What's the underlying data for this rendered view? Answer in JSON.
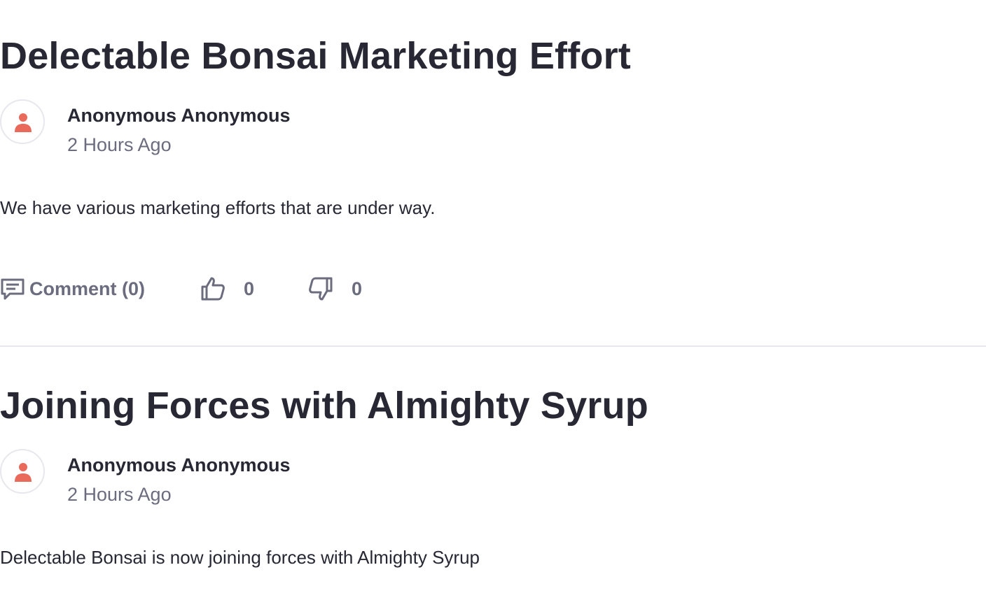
{
  "posts": [
    {
      "title": "Delectable Bonsai Marketing Effort",
      "author": "Anonymous Anonymous",
      "time": "2 Hours Ago",
      "body": "We have various marketing efforts that are under way.",
      "actions": {
        "comment_label": "Comment (0)",
        "likes": "0",
        "dislikes": "0"
      }
    },
    {
      "title": "Joining Forces with Almighty Syrup",
      "author": "Anonymous Anonymous",
      "time": "2 Hours Ago",
      "body": "Delectable Bonsai is now joining forces with Almighty Syrup"
    }
  ],
  "icons": {
    "avatar": "user-icon",
    "comment": "comment-icon",
    "like": "thumbs-up-icon",
    "dislike": "thumbs-down-icon"
  },
  "colors": {
    "avatar_accent": "#e9695b",
    "text_primary": "#272833",
    "text_secondary": "#6b6c7e",
    "divider": "#e7e7ed"
  }
}
